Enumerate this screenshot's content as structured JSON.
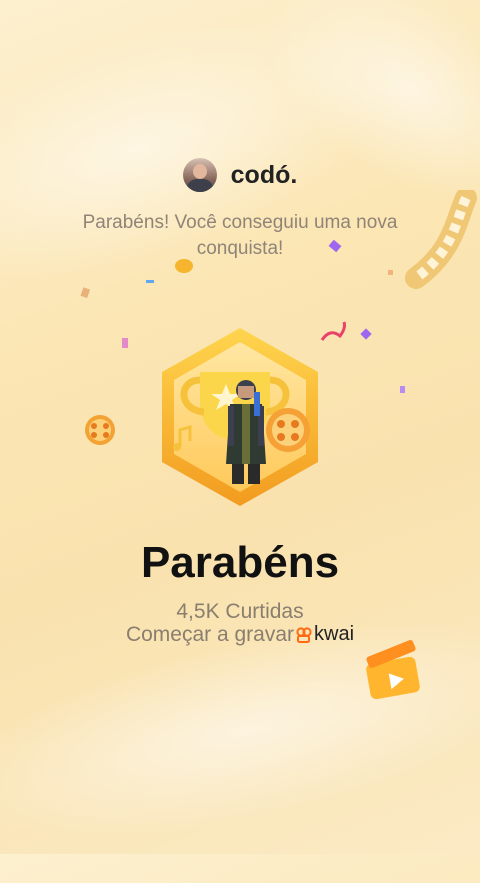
{
  "user": {
    "name": "codó."
  },
  "subtitle": "Parabéns! Você conseguiu uma nova conquista!",
  "title": "Parabéns",
  "likes": "4,5K Curtidas",
  "cta": "Começar a gravar",
  "brand": "kwai",
  "colors": {
    "background": "#fbe6b4",
    "badge_gold": "#f6b52c",
    "brand_orange": "#ff6a13"
  }
}
